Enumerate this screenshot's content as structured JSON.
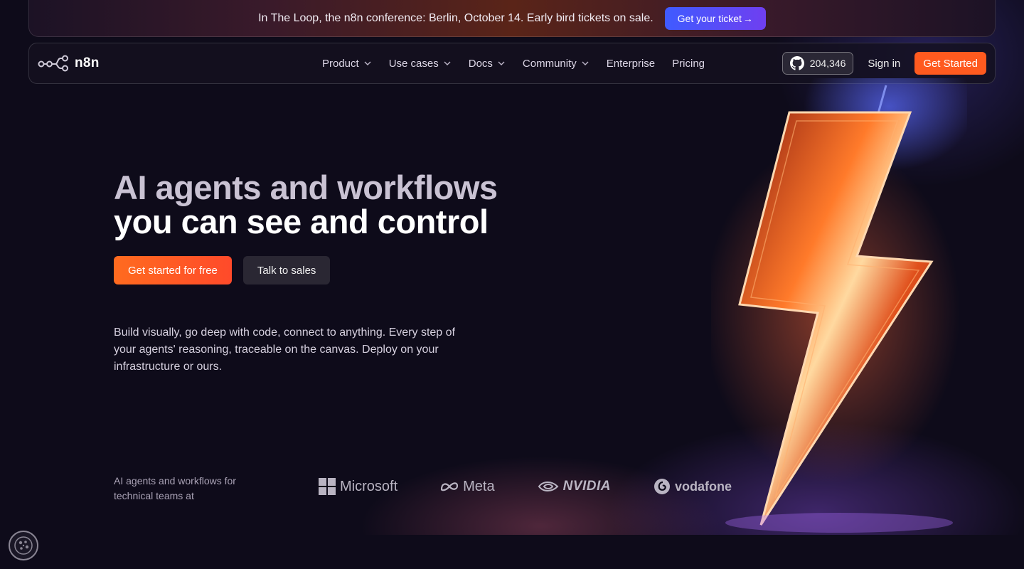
{
  "announcement": {
    "text": "In The Loop, the n8n conference: Berlin, October 14. Early bird tickets on sale.",
    "button_label": "Get your ticket",
    "button_arrow": "→"
  },
  "nav": {
    "logo_text": "n8n",
    "menu": [
      {
        "label": "Product",
        "has_dropdown": true
      },
      {
        "label": "Use cases",
        "has_dropdown": true
      },
      {
        "label": "Docs",
        "has_dropdown": true
      },
      {
        "label": "Community",
        "has_dropdown": true
      },
      {
        "label": "Enterprise",
        "has_dropdown": false
      },
      {
        "label": "Pricing",
        "has_dropdown": false
      }
    ],
    "github_stars": "204,346",
    "signin_label": "Sign in",
    "get_started_label": "Get Started"
  },
  "hero": {
    "headline_line1": "AI agents and workflows",
    "headline_line2": "you can see and control",
    "cta_primary": "Get started for free",
    "cta_secondary": "Talk to sales",
    "description": "Build visually, go deep with code, connect to anything. Every step of your agents' reasoning, traceable on the canvas. Deploy on your infrastructure or ours."
  },
  "trust": {
    "caption": "AI agents and workflows for technical teams at",
    "logos": [
      "Microsoft",
      "Meta",
      "NVIDIA",
      "vodafone"
    ]
  },
  "colors": {
    "accent": "#ff5a1f",
    "ticket_gradient_start": "#3f5bff",
    "ticket_gradient_end": "#6f3ff0",
    "background": "#0e0b1a"
  },
  "icons": [
    "n8n-logo-icon",
    "chevron-down-icon",
    "github-icon",
    "microsoft-icon",
    "meta-icon",
    "nvidia-icon",
    "vodafone-icon",
    "cookie-icon",
    "lightning-bolt-icon"
  ]
}
